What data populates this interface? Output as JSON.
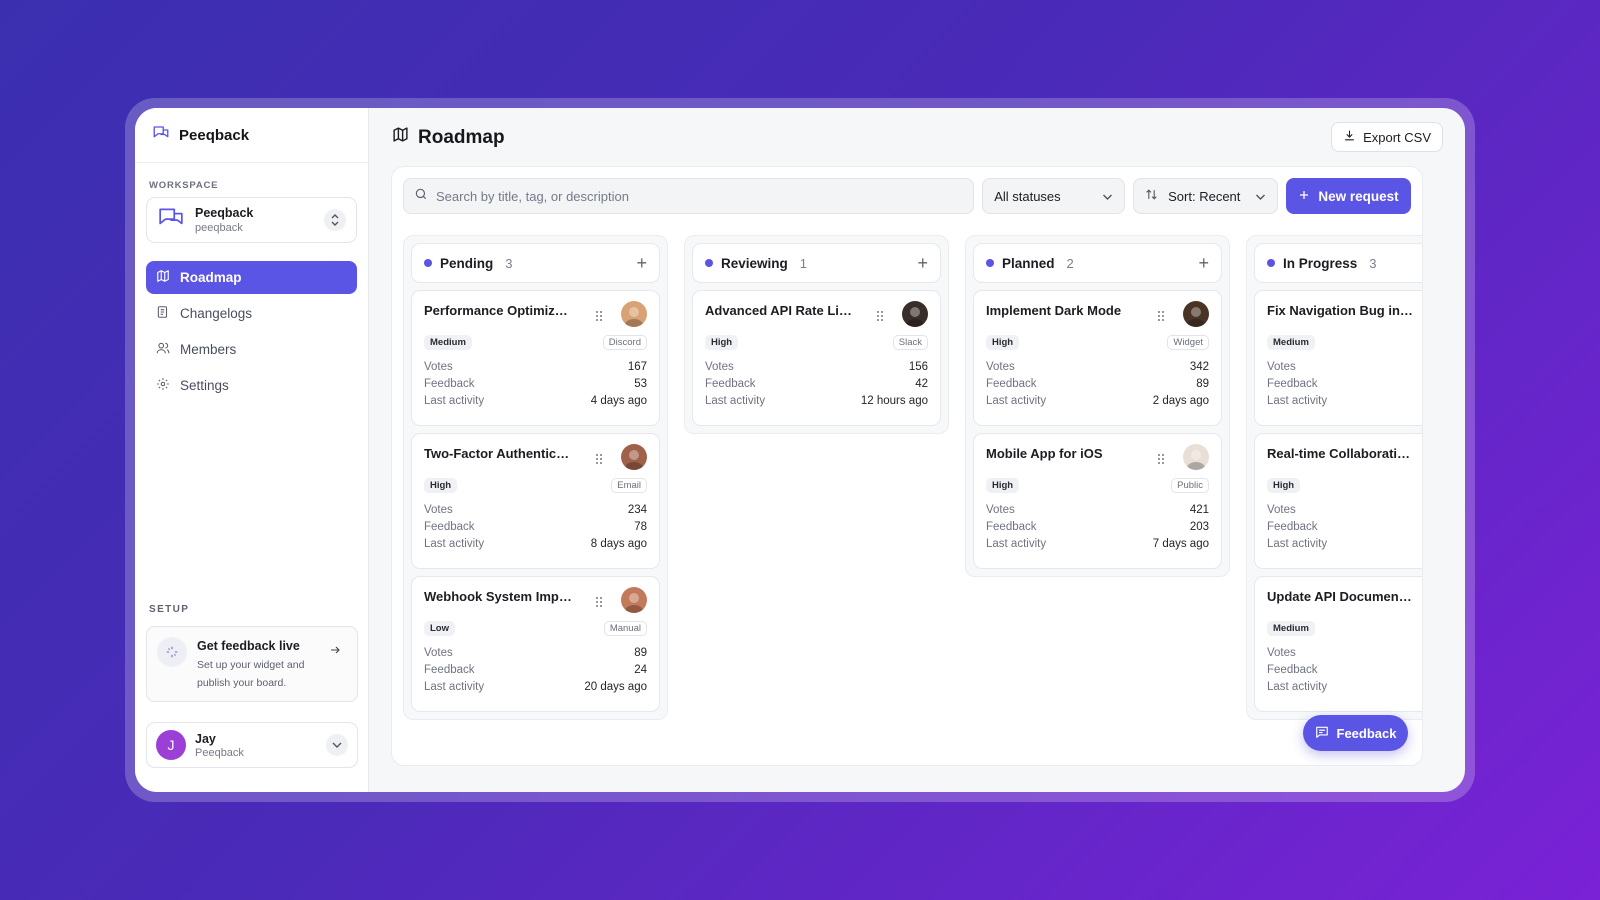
{
  "app": {
    "name": "Peeqback"
  },
  "sidebar": {
    "workspace_label": "WORKSPACE",
    "workspace": {
      "name": "Peeqback",
      "slug": "peeqback"
    },
    "nav": [
      {
        "label": "Roadmap",
        "icon": "map-icon",
        "active": true
      },
      {
        "label": "Changelogs",
        "icon": "changelog-icon",
        "active": false
      },
      {
        "label": "Members",
        "icon": "members-icon",
        "active": false
      },
      {
        "label": "Settings",
        "icon": "gear-icon",
        "active": false
      }
    ],
    "setup_label": "SETUP",
    "setup_card": {
      "title": "Get feedback live",
      "description": "Set up your widget and publish your board."
    },
    "user": {
      "initial": "J",
      "name": "Jay",
      "org": "Peeqback"
    }
  },
  "header": {
    "title": "Roadmap",
    "export_label": "Export CSV"
  },
  "toolbar": {
    "search_placeholder": "Search by title, tag, or description",
    "status_filter": "All statuses",
    "sort": "Sort: Recent",
    "new_request": "New request"
  },
  "columns": [
    {
      "title": "Pending",
      "count": "3",
      "cards": [
        {
          "title": "Performance Optimizati...",
          "priority": "Medium",
          "source": "Discord",
          "votes": "167",
          "feedback": "53",
          "last_activity": "4 days ago",
          "avatar_color": "#d9a274"
        },
        {
          "title": "Two-Factor Authenticati...",
          "priority": "High",
          "source": "Email",
          "votes": "234",
          "feedback": "78",
          "last_activity": "8 days ago",
          "avatar_color": "#a0614a"
        },
        {
          "title": "Webhook System Imple...",
          "priority": "Low",
          "source": "Manual",
          "votes": "89",
          "feedback": "24",
          "last_activity": "20 days ago",
          "avatar_color": "#c27a5a"
        }
      ]
    },
    {
      "title": "Reviewing",
      "count": "1",
      "cards": [
        {
          "title": "Advanced API Rate Limiti...",
          "priority": "High",
          "source": "Slack",
          "votes": "156",
          "feedback": "42",
          "last_activity": "12 hours ago",
          "avatar_color": "#3a2e2a"
        }
      ]
    },
    {
      "title": "Planned",
      "count": "2",
      "cards": [
        {
          "title": "Implement Dark Mode",
          "priority": "High",
          "source": "Widget",
          "votes": "342",
          "feedback": "89",
          "last_activity": "2 days ago",
          "avatar_color": "#4a3426"
        },
        {
          "title": "Mobile App for iOS",
          "priority": "High",
          "source": "Public",
          "votes": "421",
          "feedback": "203",
          "last_activity": "7 days ago",
          "avatar_color": "#e9dfd6"
        }
      ]
    },
    {
      "title": "In Progress",
      "count": "3",
      "cards": [
        {
          "title": "Fix Navigation Bug in Ad...",
          "priority": "Medium",
          "source": "",
          "votes": "",
          "feedback": "",
          "last_activity": "",
          "avatar_color": ""
        },
        {
          "title": "Real-time Collaboration ...",
          "priority": "High",
          "source": "",
          "votes": "",
          "feedback": "",
          "last_activity": "",
          "avatar_color": ""
        },
        {
          "title": "Update API Documentati...",
          "priority": "Medium",
          "source": "",
          "votes": "",
          "feedback": "",
          "last_activity": "",
          "avatar_color": ""
        }
      ]
    }
  ],
  "card_labels": {
    "votes": "Votes",
    "feedback": "Feedback",
    "last_activity": "Last activity"
  },
  "feedback_button": "Feedback",
  "colors": {
    "accent": "#5b55e6",
    "background_gradient_start": "#3b2fb0",
    "background_gradient_end": "#7a22d6"
  }
}
